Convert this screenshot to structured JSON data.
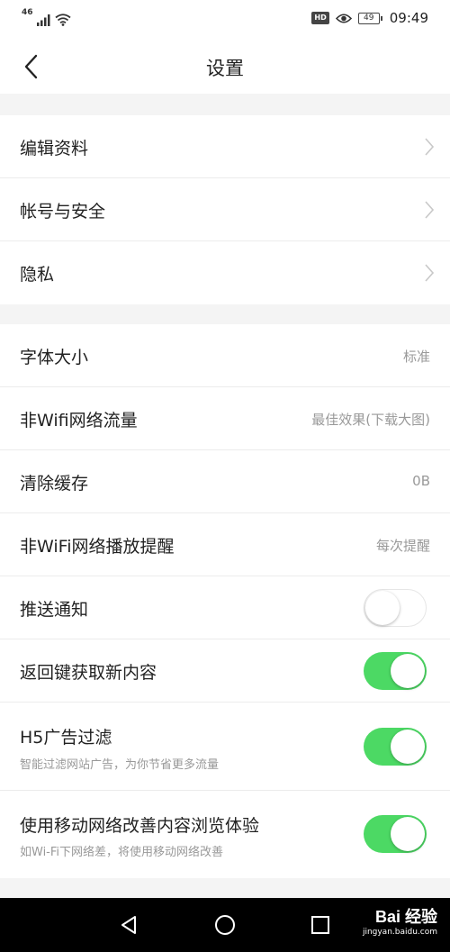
{
  "status_bar": {
    "network": "46",
    "hd": "HD",
    "battery": "49",
    "time": "09:49",
    "icons": [
      "signal-icon",
      "wifi-icon",
      "eye-icon",
      "battery-icon"
    ]
  },
  "nav": {
    "title": "设置",
    "back_icon": "chevron-left-icon"
  },
  "group1": [
    {
      "label": "编辑资料"
    },
    {
      "label": "帐号与安全"
    },
    {
      "label": "隐私"
    }
  ],
  "group2": {
    "font_size": {
      "label": "字体大小",
      "value": "标准"
    },
    "non_wifi_traffic": {
      "label": "非Wifi网络流量",
      "value": "最佳效果(下载大图)"
    },
    "clear_cache": {
      "label": "清除缓存",
      "value": "0B"
    },
    "non_wifi_play": {
      "label": "非WiFi网络播放提醒",
      "value": "每次提醒"
    },
    "push": {
      "label": "推送通知",
      "on": false
    },
    "back_refresh": {
      "label": "返回键获取新内容",
      "on": true
    },
    "h5_ad": {
      "label": "H5广告过滤",
      "sub": "智能过滤网站广告，为你节省更多流量",
      "on": true
    },
    "mobile_improve": {
      "label": "使用移动网络改善内容浏览体验",
      "sub": "如Wi-Fi下网络差，将使用移动网络改善",
      "on": true
    }
  },
  "colors": {
    "toggle_on": "#4cd964",
    "background": "#f4f4f4"
  },
  "watermark": {
    "main": "Bai 经验",
    "sub": "jingyan.baidu.com"
  }
}
